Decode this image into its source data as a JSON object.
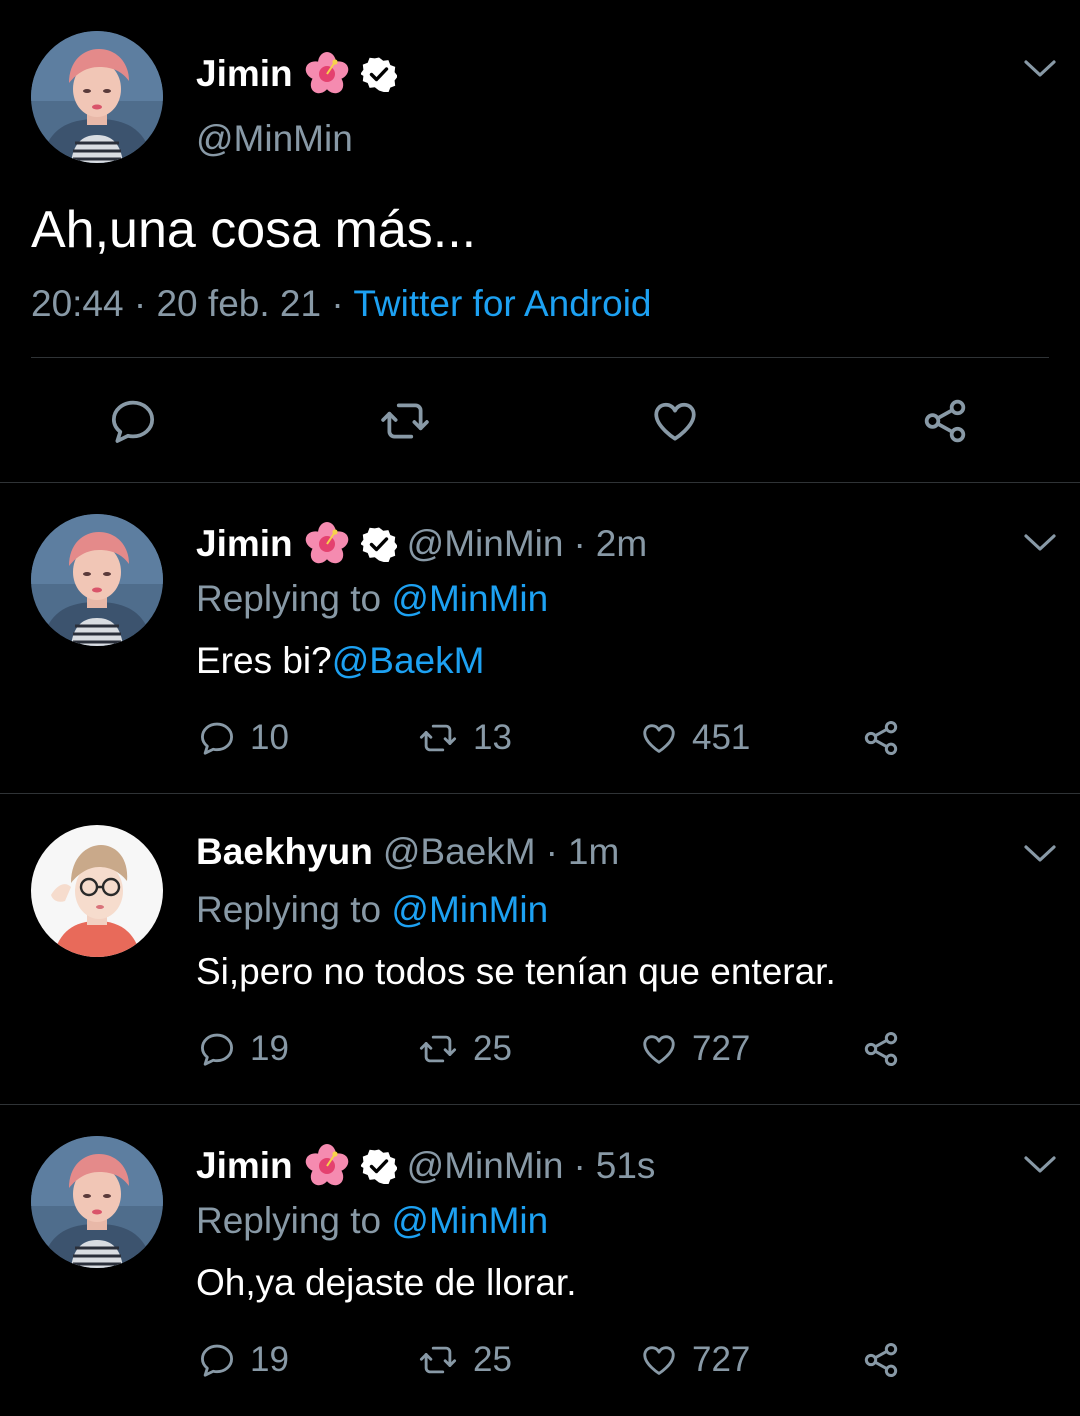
{
  "main_tweet": {
    "name": "Jimin",
    "handle": "@MinMin",
    "text": "Ah,una cosa más...",
    "time": "20:44",
    "separator1": "·",
    "date": "20 feb. 21",
    "separator2": "·",
    "client": "Twitter for Android"
  },
  "replies": [
    {
      "name": "Jimin",
      "handle": "@MinMin",
      "dot": "·",
      "age": "2m",
      "replying_prefix": "Replying to ",
      "replying_handle": "@MinMin",
      "text": "Eres bi?",
      "text_mention": "@BaekM",
      "replies_count": "10",
      "retweets_count": "13",
      "likes_count": "451"
    },
    {
      "name": "Baekhyun",
      "handle": "@BaekM",
      "dot": "·",
      "age": "1m",
      "replying_prefix": "Replying to ",
      "replying_handle": "@MinMin",
      "text": "Si,pero no todos se tenían que enterar.",
      "replies_count": "19",
      "retweets_count": "25",
      "likes_count": "727"
    },
    {
      "name": "Jimin",
      "handle": "@MinMin",
      "dot": "·",
      "age": "51s",
      "replying_prefix": "Replying to ",
      "replying_handle": "@MinMin",
      "text": "Oh,ya dejaste de llorar.",
      "replies_count": "19",
      "retweets_count": "25",
      "likes_count": "727"
    }
  ],
  "icons": [
    "reply-icon",
    "retweet-icon",
    "like-icon",
    "share-icon",
    "verified-icon",
    "hibiscus-icon",
    "chevron-down-icon"
  ],
  "colors": {
    "background": "#000000",
    "accent": "#1da1f2",
    "secondary_text": "#8899a6",
    "divider": "#2f3336"
  }
}
